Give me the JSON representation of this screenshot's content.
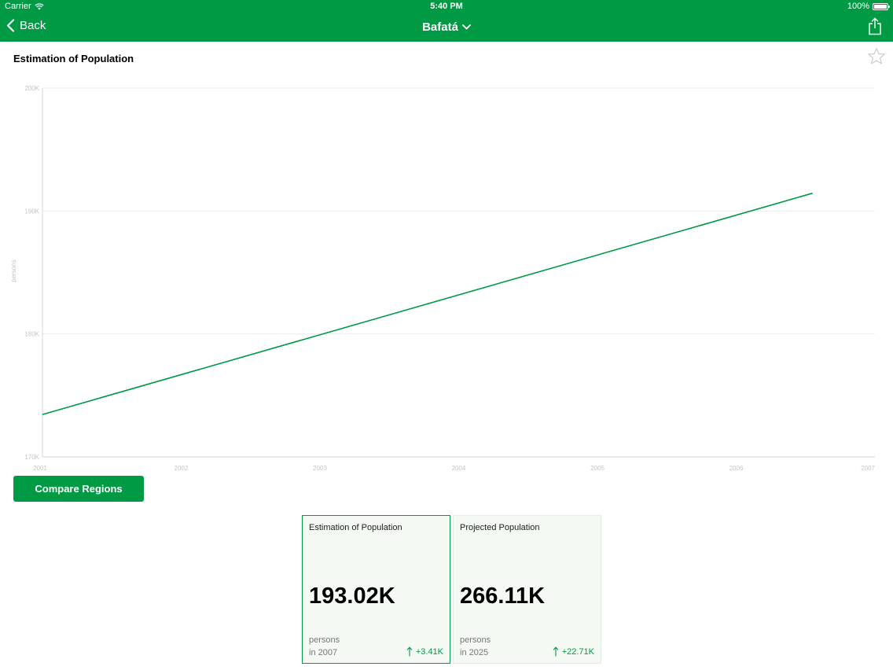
{
  "status": {
    "carrier": "Carrier",
    "time": "5:40 PM",
    "battery": "100%",
    "battery_level": 1.0
  },
  "nav": {
    "back_label": "Back",
    "title": "Bafatá"
  },
  "page": {
    "title": "Estimation of Population"
  },
  "chart_data": {
    "type": "line",
    "title": "",
    "xlabel": "",
    "ylabel": "persons",
    "x": [
      2001,
      2006.55
    ],
    "xlim": [
      2001,
      2007
    ],
    "ylim": [
      170000,
      200000
    ],
    "xticks": [
      "2001",
      "2002",
      "2003",
      "2004",
      "2005",
      "2006",
      "2007"
    ],
    "yticks": [
      "170K",
      "180K",
      "190K",
      "200K"
    ],
    "grid": true,
    "series": [
      {
        "values": [
          173450,
          191450
        ]
      }
    ],
    "color": "#009a44"
  },
  "compare_button": {
    "label": "Compare Regions"
  },
  "cards": [
    {
      "title": "Estimation of Population",
      "value": "193.02K",
      "unit": "persons",
      "year": "in 2007",
      "change": "+3.41K"
    },
    {
      "title": "Projected Population",
      "value": "266.11K",
      "unit": "persons",
      "year": "in 2025",
      "change": "+22.71K"
    }
  ],
  "colors": {
    "accent": "#009a44",
    "card_bg": "#f4f9f4"
  }
}
